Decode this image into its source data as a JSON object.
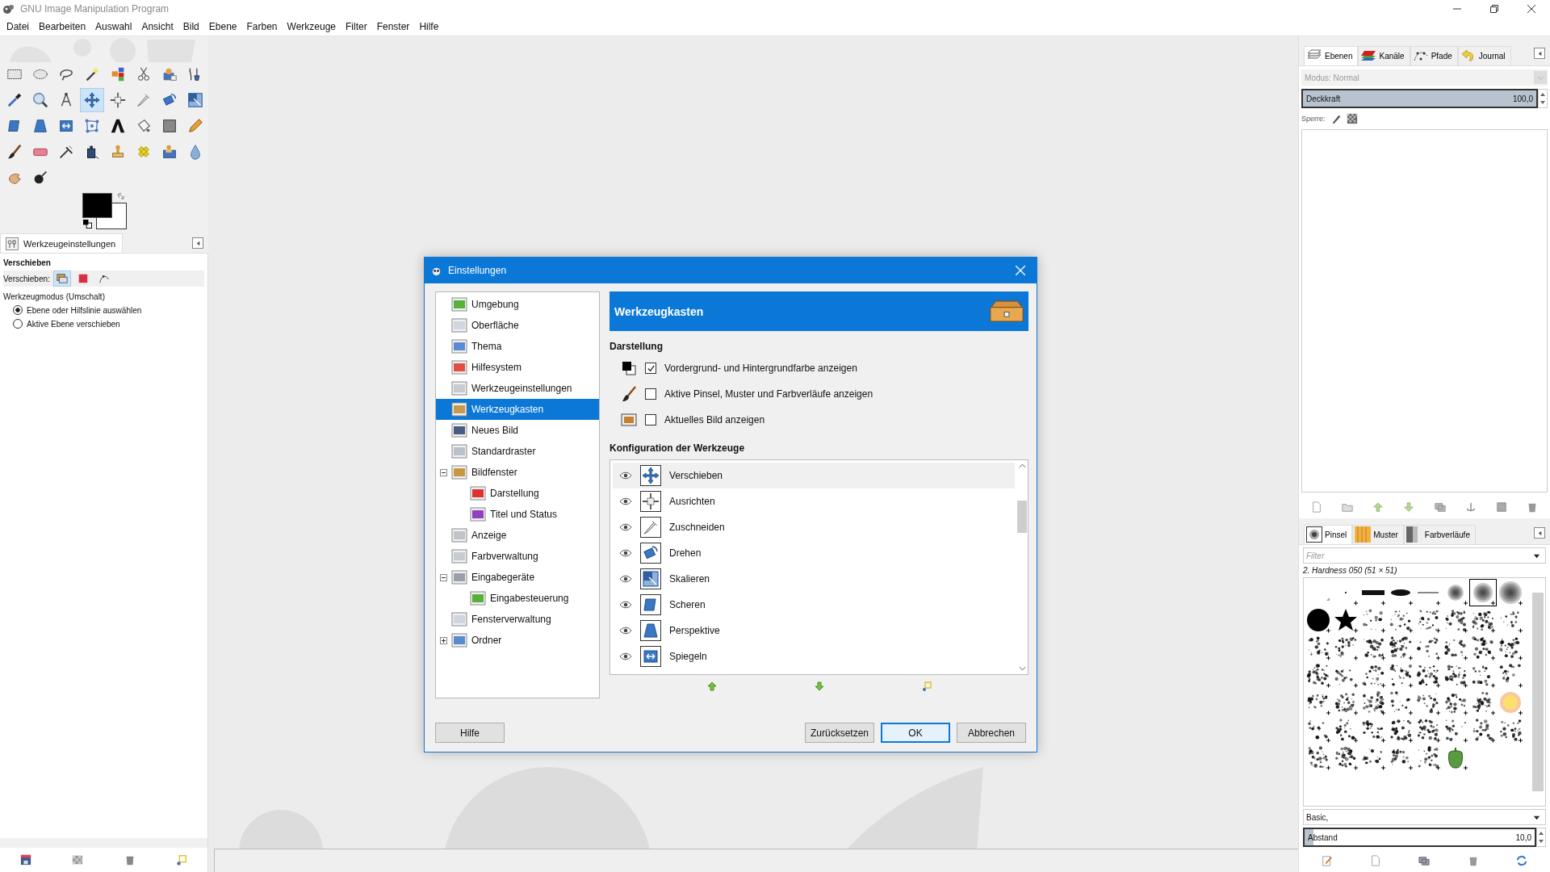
{
  "window": {
    "title": "GNU Image Manipulation Program"
  },
  "menu": [
    {
      "label": "Datei"
    },
    {
      "label": "Bearbeiten"
    },
    {
      "label": "Auswahl"
    },
    {
      "label": "Ansicht"
    },
    {
      "label": "Bild"
    },
    {
      "label": "Ebene"
    },
    {
      "label": "Farben"
    },
    {
      "label": "Werkzeuge"
    },
    {
      "label": "Filter"
    },
    {
      "label": "Fenster"
    },
    {
      "label": "Hilfe"
    }
  ],
  "toolbox": {
    "tools": [
      {
        "selected": false
      },
      {
        "selected": false
      },
      {
        "selected": false
      },
      {
        "selected": false
      },
      {
        "selected": false
      },
      {
        "selected": false
      },
      {
        "selected": false
      },
      {
        "selected": false
      },
      {
        "selected": false
      },
      {
        "selected": false
      },
      {
        "selected": false
      },
      {
        "selected": true
      },
      {
        "selected": false
      },
      {
        "selected": false
      },
      {
        "selected": false
      },
      {
        "selected": false
      },
      {
        "selected": false
      },
      {
        "selected": false
      },
      {
        "selected": false
      },
      {
        "selected": false
      },
      {
        "selected": false
      },
      {
        "selected": false
      },
      {
        "selected": false
      },
      {
        "selected": false
      },
      {
        "selected": false
      },
      {
        "selected": false
      },
      {
        "selected": false
      },
      {
        "selected": false
      },
      {
        "selected": false
      },
      {
        "selected": false
      },
      {
        "selected": false
      },
      {
        "selected": false
      },
      {
        "selected": false
      },
      {
        "selected": false
      }
    ]
  },
  "tool_options": {
    "tab": "Werkzeugeinstellungen",
    "title": "Verschieben",
    "move_label": "Verschieben:",
    "move_modes": [
      {
        "selected": true
      },
      {
        "selected": false
      },
      {
        "selected": false
      }
    ],
    "mode_label": "Werkzeugmodus (Umschalt)",
    "radios": [
      {
        "label": "Ebene oder Hilfslinie auswählen",
        "selected": true
      },
      {
        "label": "Aktive Ebene verschieben",
        "selected": false
      }
    ]
  },
  "dialog": {
    "title": "Einstellungen",
    "nav": [
      {
        "label": "Umgebung",
        "selected": false
      },
      {
        "label": "Oberfläche",
        "selected": false
      },
      {
        "label": "Thema",
        "selected": false
      },
      {
        "label": "Hilfesystem",
        "selected": false
      },
      {
        "label": "Werkzeugeinstellungen",
        "selected": false
      },
      {
        "label": "Werkzeugkasten",
        "selected": true
      },
      {
        "label": "Neues Bild",
        "selected": false
      },
      {
        "label": "Standardraster",
        "selected": false
      },
      {
        "label": "Bildfenster",
        "selected": false,
        "expanded": true,
        "children": [
          {
            "label": "Darstellung",
            "selected": false
          },
          {
            "label": "Titel und Status",
            "selected": false
          }
        ]
      },
      {
        "label": "Anzeige",
        "selected": false
      },
      {
        "label": "Farbverwaltung",
        "selected": false
      },
      {
        "label": "Eingabegeräte",
        "selected": false,
        "expanded": true,
        "children": [
          {
            "label": "Eingabesteuerung",
            "selected": false
          }
        ]
      },
      {
        "label": "Fensterverwaltung",
        "selected": false
      },
      {
        "label": "Ordner",
        "selected": false,
        "expanded": false
      }
    ],
    "header": "Werkzeugkasten",
    "section_display": "Darstellung",
    "options": [
      {
        "label": "Vordergrund- und Hintergrundfarbe anzeigen",
        "checked": true
      },
      {
        "label": "Aktive Pinsel, Muster und Farbverläufe anzeigen",
        "checked": false
      },
      {
        "label": "Aktuelles Bild anzeigen",
        "checked": false
      }
    ],
    "section_tools": "Konfiguration der Werkzeuge",
    "tools": [
      {
        "label": "Verschieben",
        "visible": true,
        "selected": true
      },
      {
        "label": "Ausrichten",
        "visible": true,
        "selected": false
      },
      {
        "label": "Zuschneiden",
        "visible": true,
        "selected": false
      },
      {
        "label": "Drehen",
        "visible": true,
        "selected": false
      },
      {
        "label": "Skalieren",
        "visible": true,
        "selected": false
      },
      {
        "label": "Scheren",
        "visible": true,
        "selected": false
      },
      {
        "label": "Perspektive",
        "visible": true,
        "selected": false
      },
      {
        "label": "Spiegeln",
        "visible": true,
        "selected": false
      }
    ],
    "buttons": [
      {
        "label": "Hilfe",
        "focused": false
      },
      {
        "label": "Zurücksetzen",
        "focused": false
      },
      {
        "label": "OK",
        "focused": true
      },
      {
        "label": "Abbrechen",
        "focused": false
      }
    ]
  },
  "layers_panel": {
    "tabs": [
      {
        "label": "Ebenen",
        "selected": true
      },
      {
        "label": "Kanäle",
        "selected": false
      },
      {
        "label": "Pfade",
        "selected": false
      },
      {
        "label": "Journal",
        "selected": false
      }
    ],
    "mode_label": "Modus:",
    "mode_value": "Normal",
    "opacity_label": "Deckkraft",
    "opacity_value": "100,0",
    "level": 1,
    "lock_label": "Sperre:"
  },
  "brushes_panel": {
    "tabs": [
      {
        "label": "Pinsel",
        "selected": true
      },
      {
        "label": "Muster",
        "selected": false
      },
      {
        "label": "Farbverläufe",
        "selected": false
      }
    ],
    "filter": {
      "placeholder": "Filter"
    },
    "brush_name": "2. Hardness 050 (51 × 51)",
    "brushes": [
      {
        "selected": false
      },
      {
        "selected": false
      },
      {
        "selected": false
      },
      {
        "selected": false
      },
      {
        "selected": false
      },
      {
        "selected": false
      },
      {
        "selected": true
      },
      {
        "selected": false
      },
      {
        "selected": false
      },
      {
        "selected": false
      },
      {
        "selected": false
      },
      {
        "selected": false
      },
      {
        "selected": false
      },
      {
        "selected": false
      },
      {
        "selected": false
      },
      {
        "selected": false
      },
      {
        "selected": false
      },
      {
        "selected": false
      },
      {
        "selected": false
      },
      {
        "selected": false
      },
      {
        "selected": false
      },
      {
        "selected": false
      },
      {
        "selected": false
      },
      {
        "selected": false
      },
      {
        "selected": false
      },
      {
        "selected": false
      },
      {
        "selected": false
      },
      {
        "selected": false
      },
      {
        "selected": false
      },
      {
        "selected": false
      },
      {
        "selected": false
      },
      {
        "selected": false
      },
      {
        "selected": false
      },
      {
        "selected": false
      },
      {
        "selected": false
      },
      {
        "selected": false
      },
      {
        "selected": false
      },
      {
        "selected": false
      },
      {
        "selected": false
      },
      {
        "selected": false
      },
      {
        "selected": false
      },
      {
        "selected": false
      },
      {
        "selected": false
      },
      {
        "selected": false
      },
      {
        "selected": false
      },
      {
        "selected": false
      },
      {
        "selected": false
      },
      {
        "selected": false
      },
      {
        "selected": false
      },
      {
        "selected": false
      },
      {
        "selected": false
      },
      {
        "selected": false
      },
      {
        "selected": false
      },
      {
        "selected": false
      }
    ],
    "tag": "Basic,",
    "spacing_label": "Abstand",
    "spacing_value": "10,0",
    "level": 0.04
  }
}
